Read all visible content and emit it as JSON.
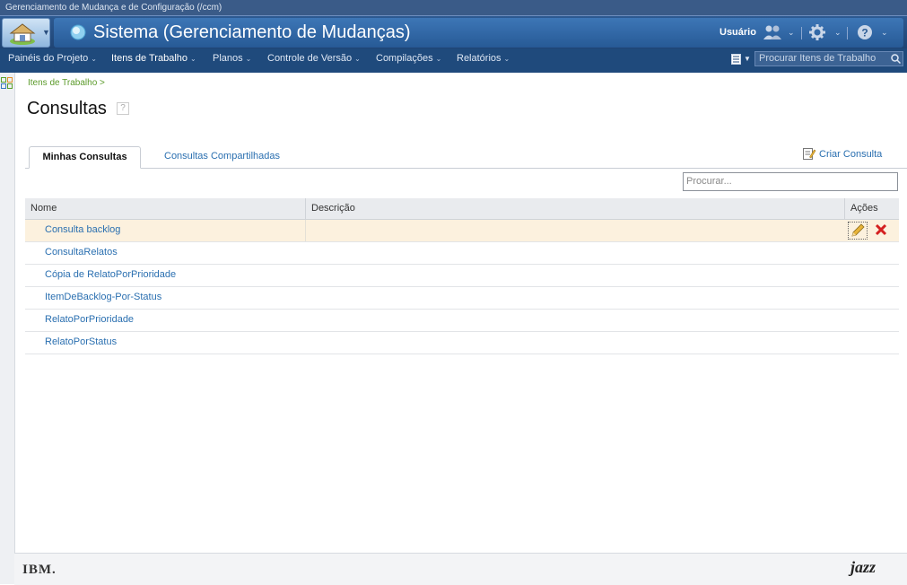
{
  "topbar": {
    "title": "Gerenciamento de Mudança e de Configuração (/ccm)"
  },
  "banner": {
    "app_title": "Sistema (Gerenciamento de Mudanças)",
    "user_label": "Usuário"
  },
  "nav": {
    "items": [
      {
        "label": "Painéis do Projeto"
      },
      {
        "label": "Itens de Trabalho"
      },
      {
        "label": "Planos"
      },
      {
        "label": "Controle de Versão"
      },
      {
        "label": "Compilações"
      },
      {
        "label": "Relatórios"
      }
    ],
    "search_placeholder": "Procurar Itens de Trabalho"
  },
  "breadcrumb": "Itens de Trabalho >",
  "page_title": "Consultas",
  "tabs": [
    {
      "label": "Minhas Consultas",
      "active": true
    },
    {
      "label": "Consultas Compartilhadas",
      "active": false
    }
  ],
  "create_query_label": "Criar Consulta",
  "filter_placeholder": "Procurar...",
  "table": {
    "columns": [
      "Nome",
      "Descrição",
      "Ações"
    ],
    "rows": [
      {
        "name": "Consulta backlog",
        "description": ""
      },
      {
        "name": "ConsultaRelatos",
        "description": ""
      },
      {
        "name": "Cópia de RelatoPorPrioridade",
        "description": ""
      },
      {
        "name": "ItemDeBacklog-Por-Status",
        "description": ""
      },
      {
        "name": "RelatoPorPrioridade",
        "description": ""
      },
      {
        "name": "RelatoPorStatus",
        "description": ""
      }
    ]
  },
  "footer": {
    "left_logo": "IBM.",
    "right_logo": "jazz"
  }
}
